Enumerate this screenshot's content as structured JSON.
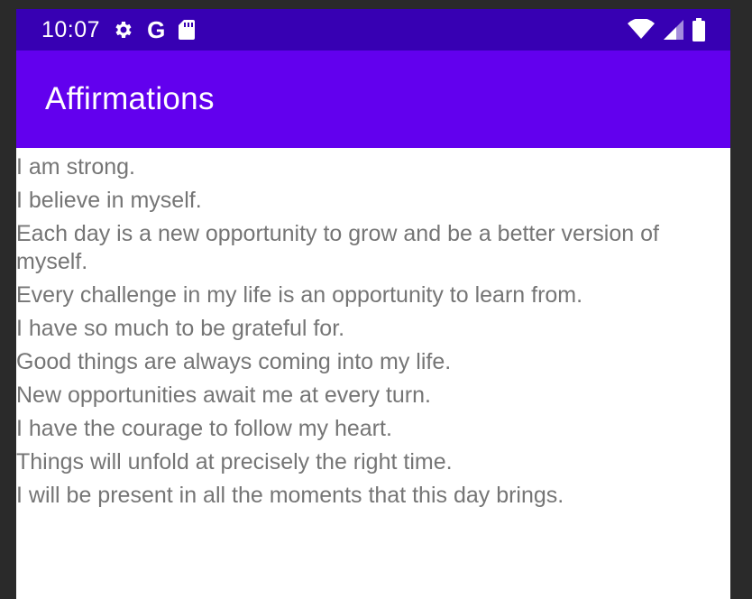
{
  "status_bar": {
    "time": "10:07",
    "icons_left": [
      "gear-icon",
      "google-g-icon",
      "sd-card-icon"
    ],
    "icons_right": [
      "wifi-icon",
      "signal-icon",
      "battery-icon"
    ],
    "google_letter": "G"
  },
  "app_bar": {
    "title": "Affirmations",
    "color": "#6200ee",
    "status_color": "#3700b3"
  },
  "affirmations": [
    "I am strong.",
    "I believe in myself.",
    "Each day is a new opportunity to grow and be a better version of myself.",
    "Every challenge in my life is an opportunity to learn from.",
    "I have so much to be grateful for.",
    "Good things are always coming into my life.",
    "New opportunities await me at every turn.",
    "I have the courage to follow my heart.",
    "Things will unfold at precisely the right time.",
    "I will be present in all the moments that this day brings."
  ]
}
